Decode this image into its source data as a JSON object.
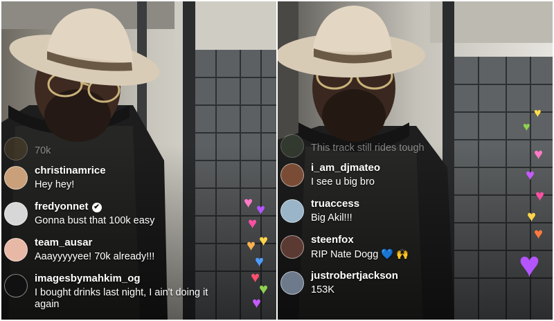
{
  "left": {
    "comments": [
      {
        "user": "",
        "text": "70k",
        "faded": true,
        "avatar_color": "#5b4a2c"
      },
      {
        "user": "christinamrice",
        "text": "Hey hey!",
        "avatar_color": "#c9a07a"
      },
      {
        "user": "fredyonnet",
        "text": "Gonna bust that 100k easy",
        "verified": true,
        "avatar_color": "#d7d7d7"
      },
      {
        "user": "team_ausar",
        "text": "Aaayyyyyee! 70k already!!!",
        "avatar_color": "#e8b8a6"
      },
      {
        "user": "imagesbymahkim_og",
        "text": "I bought drinks last night, I ain't doing it again",
        "wrap": true,
        "avatar_color": "#111111"
      }
    ]
  },
  "right": {
    "comments": [
      {
        "user": "",
        "text": "This track still rides tough",
        "faded": true,
        "avatar_color": "#4c5a44"
      },
      {
        "user": "i_am_djmateo",
        "text": "I see u big bro",
        "avatar_color": "#7a4c36"
      },
      {
        "user": "truaccess",
        "text": "Big Akil!!!",
        "avatar_color": "#9ab5c8"
      },
      {
        "user": "steenfox",
        "text": "RIP Nate Dogg",
        "emoji": "💙 🙌",
        "avatar_color": "#5a3a32"
      },
      {
        "user": "justrobertjackson",
        "text": "153K",
        "avatar_color": "#6c7a8c"
      }
    ]
  },
  "colors": {
    "accent_hearts": [
      "#ff4fa3",
      "#b455ff",
      "#ffd34a",
      "#ff7a3c",
      "#4f9cff",
      "#ff4f6d",
      "#8fd14f"
    ]
  }
}
